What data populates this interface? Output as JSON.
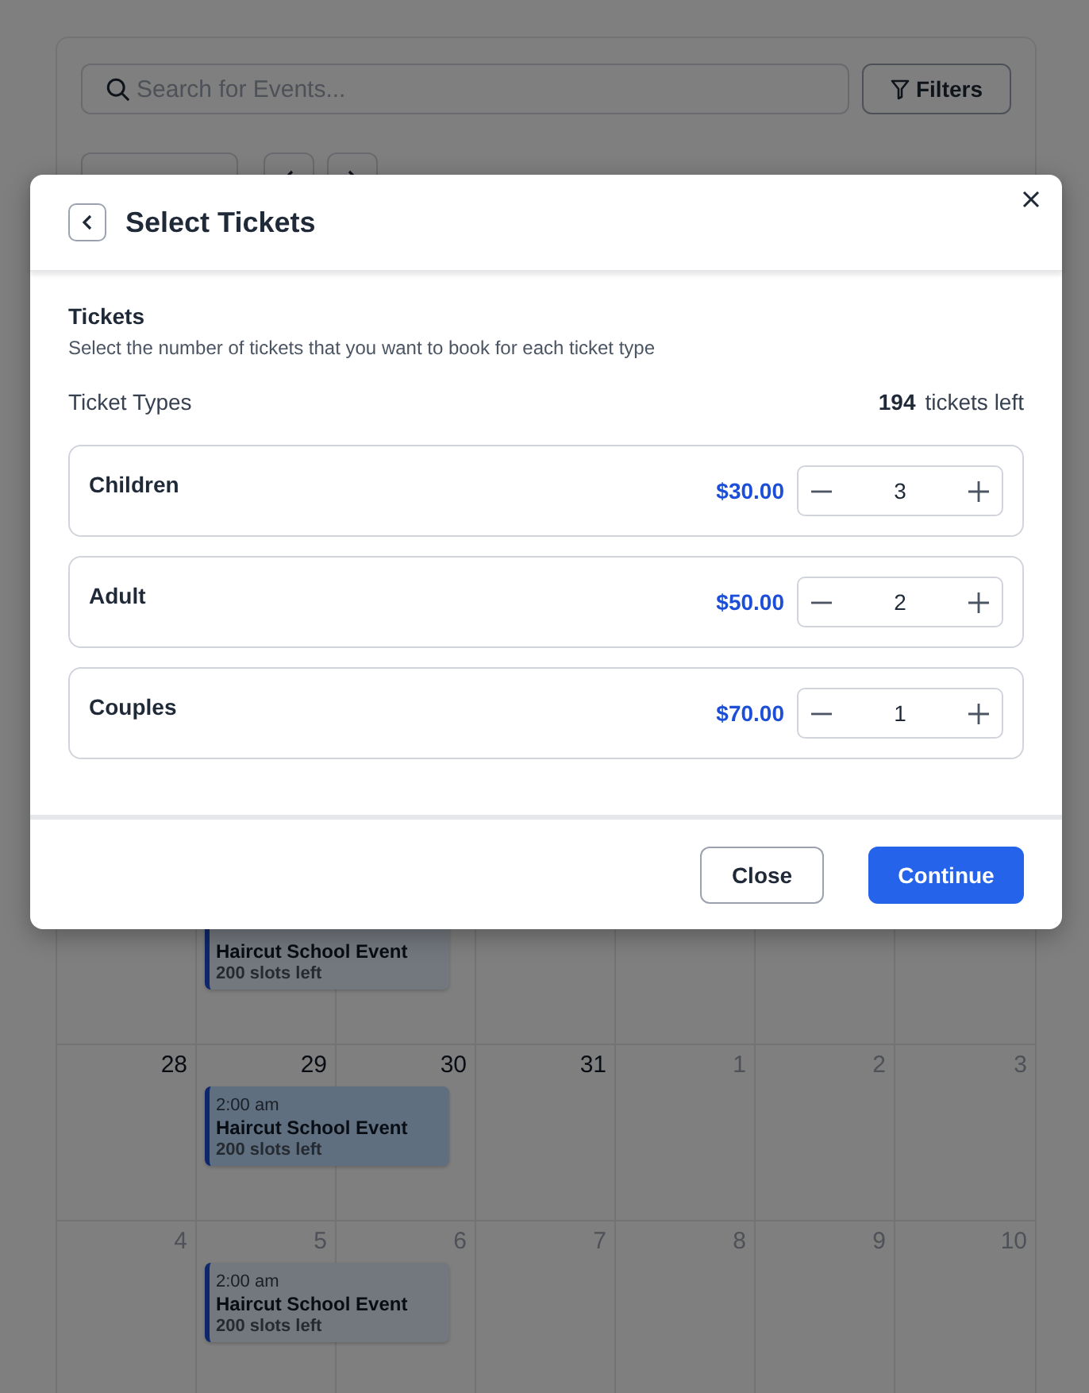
{
  "toolbar": {
    "search": {
      "placeholder": "Search for Events..."
    },
    "filters_button": "Filters"
  },
  "calendar": {
    "partial_week": {
      "events": [
        {
          "title": "Haircut School Event",
          "slots": "200 slots left",
          "selected": false,
          "spans_next_day": true
        }
      ]
    },
    "weeks": [
      {
        "days": [
          {
            "label": "28",
            "muted": false
          },
          {
            "label": "29",
            "muted": false,
            "events": [
              {
                "time": "2:00 am",
                "title": "Haircut School Event",
                "slots": "200 slots left",
                "selected": true,
                "spans_next_day": true
              }
            ]
          },
          {
            "label": "30",
            "muted": false
          },
          {
            "label": "31",
            "muted": false
          },
          {
            "label": "1",
            "muted": true
          },
          {
            "label": "2",
            "muted": true
          },
          {
            "label": "3",
            "muted": true
          }
        ]
      },
      {
        "days": [
          {
            "label": "4",
            "muted": true
          },
          {
            "label": "5",
            "muted": true,
            "events": [
              {
                "time": "2:00 am",
                "title": "Haircut School Event",
                "slots": "200 slots left",
                "selected": false,
                "spans_next_day": true
              }
            ]
          },
          {
            "label": "6",
            "muted": true
          },
          {
            "label": "7",
            "muted": true
          },
          {
            "label": "8",
            "muted": true
          },
          {
            "label": "9",
            "muted": true
          },
          {
            "label": "10",
            "muted": true
          }
        ]
      }
    ]
  },
  "dialog": {
    "title": "Select Tickets",
    "section_title": "Tickets",
    "section_description": "Select the number of tickets that you want to book for each ticket type",
    "ticket_types_label": "Ticket Types",
    "tickets_left_count": "194",
    "tickets_left_label": "tickets left",
    "tickets": [
      {
        "name": "Children",
        "price": "$30.00",
        "quantity": "3"
      },
      {
        "name": "Adult",
        "price": "$50.00",
        "quantity": "2"
      },
      {
        "name": "Couples",
        "price": "$70.00",
        "quantity": "1"
      }
    ],
    "buttons": [
      {
        "label": "Close",
        "kind": "secondary"
      },
      {
        "label": "Continue",
        "kind": "primary"
      }
    ]
  }
}
